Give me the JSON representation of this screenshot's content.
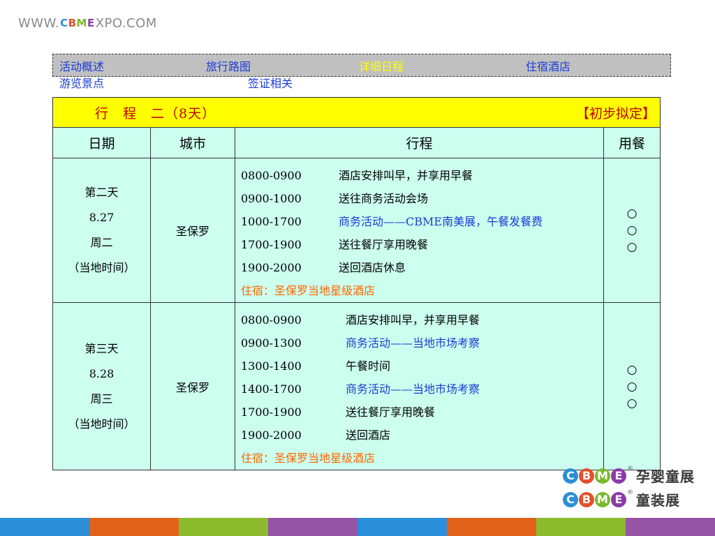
{
  "site": {
    "prefix": "WWW.",
    "brand_letters": [
      "C",
      "B",
      "M",
      "E"
    ],
    "suffix": "XPO.COM"
  },
  "nav": {
    "items": [
      {
        "label": "活动概述",
        "active": false
      },
      {
        "label": "旅行路图",
        "active": false
      },
      {
        "label": "详细日程",
        "active": true
      },
      {
        "label": "住宿酒店",
        "active": false
      },
      {
        "label": "游览景点",
        "active": false
      },
      {
        "label": "签证相关",
        "active": false
      }
    ]
  },
  "schedule": {
    "title": "行　程　二（8天）",
    "status": "【初步拟定】",
    "headers": {
      "date": "日期",
      "city": "城市",
      "itinerary": "行程",
      "meals": "用餐"
    },
    "days": [
      {
        "day": "第二天",
        "date": "8.27",
        "weekday": "周二",
        "note": "（当地时间）",
        "city": "圣保罗",
        "items": [
          {
            "time": "0800-0900",
            "activity": "酒店安排叫早，并享用早餐",
            "highlight": false
          },
          {
            "time": "0900-1000",
            "activity": "送往商务活动会场",
            "highlight": false
          },
          {
            "time": "1000-1700",
            "activity": "商务活动——CBME南美展，午餐发餐费",
            "highlight": true
          },
          {
            "time": "1700-1900",
            "activity": "送往餐厅享用晚餐",
            "highlight": false
          },
          {
            "time": "1900-2000",
            "activity": "送回酒店休息",
            "highlight": false
          }
        ],
        "hotel": "住宿：圣保罗当地星级酒店",
        "meals": [
          "○",
          "○",
          "○"
        ]
      },
      {
        "day": "第三天",
        "date": "8.28",
        "weekday": "周三",
        "note": "（当地时间）",
        "city": "圣保罗",
        "items": [
          {
            "time": "0800-0900",
            "activity": "酒店安排叫早，并享用早餐",
            "highlight": false
          },
          {
            "time": "0900-1300",
            "activity": "商务活动——当地市场考察",
            "highlight": true
          },
          {
            "time": "1300-1400",
            "activity": "午餐时间",
            "highlight": false
          },
          {
            "time": "1400-1700",
            "activity": "商务活动——当地市场考察",
            "highlight": true
          },
          {
            "time": "1700-1900",
            "activity": "送往餐厅享用晚餐",
            "highlight": false
          },
          {
            "time": "1900-2000",
            "activity": "送回酒店",
            "highlight": false
          }
        ],
        "hotel": "住宿：圣保罗当地星级酒店",
        "meals": [
          "○",
          "○",
          "○"
        ]
      }
    ]
  },
  "cbme_logos": [
    {
      "letters": [
        "C",
        "B",
        "M",
        "E"
      ],
      "reg": "®",
      "label": "孕婴童展"
    },
    {
      "letters": [
        "C",
        "B",
        "M",
        "E"
      ],
      "reg": "®",
      "label": "童装展"
    }
  ],
  "colors": {
    "nav_bg": "#c0c0c0",
    "nav_link": "#1a3cd4",
    "nav_active": "#ffff00",
    "title_bg": "#ffff00",
    "title_text": "#c00000",
    "table_bg": "#ccffee",
    "highlight": "#1a3cd4",
    "hotel": "#ff6600",
    "brand": [
      "#2a8fd8",
      "#e2502a",
      "#7cb82f",
      "#8c3aa8"
    ],
    "bar": [
      "#2a8fd8",
      "#e2621b",
      "#8dbb2e",
      "#9654a7",
      "#2a8fd8",
      "#e2621b",
      "#8dbb2e",
      "#9654a7"
    ]
  }
}
